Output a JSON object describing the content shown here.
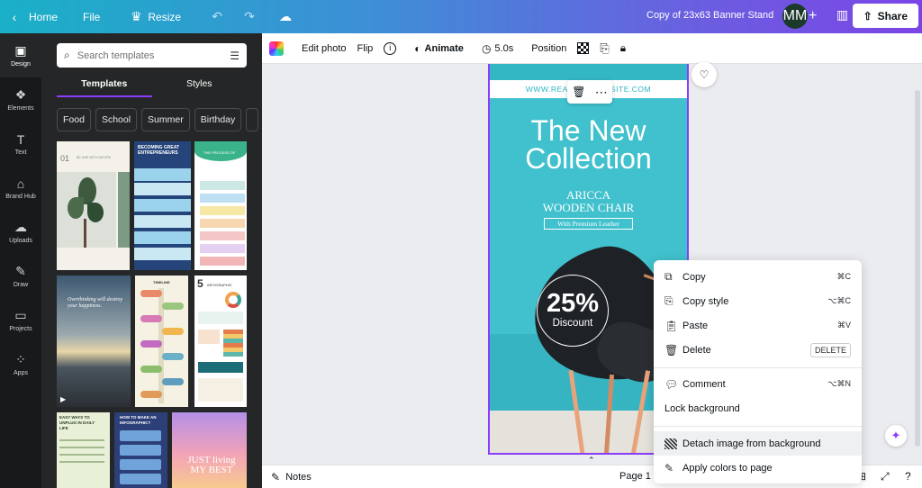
{
  "topbar": {
    "home": "Home",
    "file": "File",
    "resize": "Resize",
    "doc_title": "Copy of 23x63  Banner Stand",
    "avatar_initials": "MM",
    "share": "Share"
  },
  "rail": [
    {
      "label": "Design",
      "icon": "▣"
    },
    {
      "label": "Elements",
      "icon": "❖"
    },
    {
      "label": "Text",
      "icon": "T"
    },
    {
      "label": "Brand Hub",
      "icon": "⌂"
    },
    {
      "label": "Uploads",
      "icon": "☁"
    },
    {
      "label": "Draw",
      "icon": "✎"
    },
    {
      "label": "Projects",
      "icon": "▭"
    },
    {
      "label": "Apps",
      "icon": "⁘"
    }
  ],
  "panel": {
    "search_placeholder": "Search templates",
    "tab_templates": "Templates",
    "tab_styles": "Styles",
    "chips": [
      "Food",
      "School",
      "Summer",
      "Birthday"
    ],
    "t1": {
      "num": "01",
      "text": "BE ONE WITH NATURE"
    },
    "t2": {
      "title": "BECOMING GREAT ENTREPRENEURS"
    },
    "t3": {
      "title": "THE PROCESS OF"
    },
    "t4": {
      "text": "Overthinking will destroy your happiness."
    },
    "t5": {
      "title": "TIMELINE"
    },
    "t6": {
      "num": "5",
      "title": "INFOGRAPHIC"
    },
    "t7": {
      "title": "EASY WAYS TO UNPLUG IN DAILY LIFE"
    },
    "t8": {
      "title": "HOW TO MAKE AN INFOGRAPHIC?"
    },
    "t9": {
      "text": "JUST living MY BEST"
    }
  },
  "editor_bar": {
    "edit_photo": "Edit photo",
    "flip": "Flip",
    "animate": "Animate",
    "duration": "5.0s",
    "position": "Position"
  },
  "design": {
    "url": "WWW.REALLYGREATSITE.COM",
    "headline_1": "The New",
    "headline_2": "Collection",
    "brand_1": "ARICCA",
    "brand_2": "WOODEN CHAIR",
    "tagline": "With Premium Leather",
    "discount_value": "25%",
    "discount_label": "Discount"
  },
  "bottom": {
    "notes": "Notes",
    "page": "Page 1 /"
  },
  "context_menu": {
    "copy": "Copy",
    "copy_sc": "⌘C",
    "copy_style": "Copy style",
    "copy_style_sc": "⌥⌘C",
    "paste": "Paste",
    "paste_sc": "⌘V",
    "delete": "Delete",
    "delete_sc": "DELETE",
    "comment": "Comment",
    "comment_sc": "⌥⌘N",
    "lock_bg": "Lock background",
    "detach": "Detach image from background",
    "apply_colors": "Apply colors to page"
  },
  "colors": {
    "accent": "#8b3dff",
    "design_bg": "#40c1cd"
  }
}
